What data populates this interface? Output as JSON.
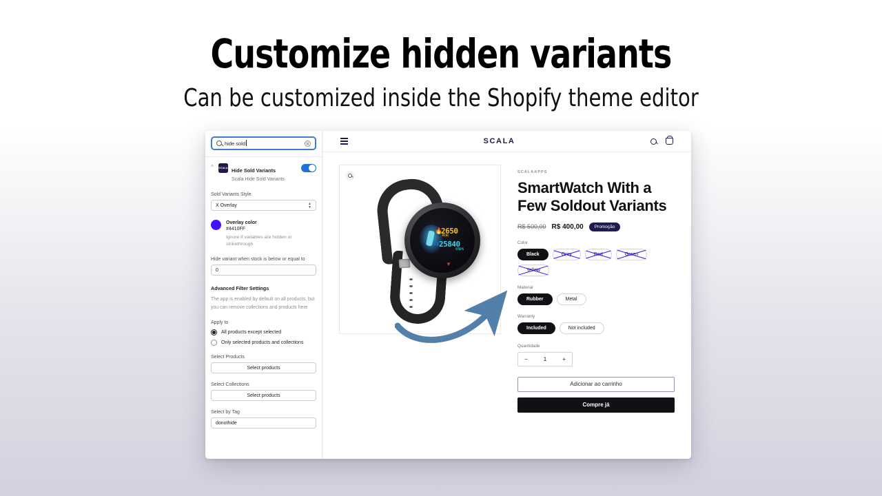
{
  "page": {
    "headline": "Customize hidden variants",
    "subheadline": "Can be customized inside the Shopify theme editor"
  },
  "editor": {
    "search": {
      "value": "hide sold",
      "clear_icon": "clear-circle-icon",
      "search_icon": "search-icon"
    },
    "app": {
      "title": "Hide Sold Variants",
      "subtitle": "Scala Hide Sold Variants",
      "icon_label": "SCALA",
      "collapse_icon": "chevron-up-icon",
      "toggle_on": true
    },
    "style_field": {
      "label": "Sold Variants Style",
      "value": "X Overlay"
    },
    "overlay_color": {
      "label": "Overlay color",
      "hex": "#4410FF",
      "note": "Ignore if variables are hidden or strikethrough"
    },
    "stock_field": {
      "label": "Hide variant when stock is below or equal to",
      "value": "0"
    },
    "advanced": {
      "title": "Advanced Filter Settings",
      "note": "The app is enabled by default on all products, but you can remove collections and products here"
    },
    "apply_to": {
      "label": "Apply to",
      "options": [
        {
          "label": "All products except selected",
          "selected": true
        },
        {
          "label": "Only selected products and collections",
          "selected": false
        }
      ]
    },
    "select_products": {
      "label": "Select Products",
      "button": "Select products"
    },
    "select_collections": {
      "label": "Select Collections",
      "button": "Select products"
    },
    "select_tag": {
      "label": "Select by Tag",
      "value": "donothide"
    }
  },
  "storefront": {
    "header": {
      "menu_icon": "hamburger-menu-icon",
      "brand": "SCALA",
      "search_icon": "search-icon",
      "cart_icon": "shopping-bag-icon"
    },
    "product_image": {
      "zoom_icon": "zoom-in-icon",
      "watch_display": {
        "calories": "2650",
        "calories_unit": "KCAL",
        "steps": "25840",
        "steps_unit": "STEPS"
      }
    },
    "product": {
      "vendor": "SCALAAPPS",
      "title": "SmartWatch With a Few Soldout Variants",
      "price_original": "R$ 500,00",
      "price_current": "R$ 400,00",
      "sale_badge": "Promoção"
    },
    "options": [
      {
        "label": "Color",
        "values": [
          {
            "label": "Black",
            "selected": true,
            "soldout": false
          },
          {
            "label": "Grey",
            "selected": false,
            "soldout": true
          },
          {
            "label": "Red",
            "selected": false,
            "soldout": true
          },
          {
            "label": "Green",
            "selected": false,
            "soldout": true
          },
          {
            "label": "Yellow",
            "selected": false,
            "soldout": true
          }
        ]
      },
      {
        "label": "Material",
        "values": [
          {
            "label": "Rubber",
            "selected": true,
            "soldout": false
          },
          {
            "label": "Metal",
            "selected": false,
            "soldout": false
          }
        ]
      },
      {
        "label": "Warranty",
        "values": [
          {
            "label": "Included",
            "selected": true,
            "soldout": false
          },
          {
            "label": "Not included",
            "selected": false,
            "soldout": false
          }
        ]
      }
    ],
    "quantity": {
      "label": "Quantidade",
      "minus": "−",
      "value": "1",
      "plus": "+"
    },
    "add_to_cart": "Adicionar ao carrinho",
    "buy_now": "Compre já"
  },
  "colors": {
    "overlay": "#4410FF",
    "brand_navy": "#1f1b4d",
    "toggle_blue": "#1f73d8",
    "arrow_blue": "#4a7aa5"
  }
}
